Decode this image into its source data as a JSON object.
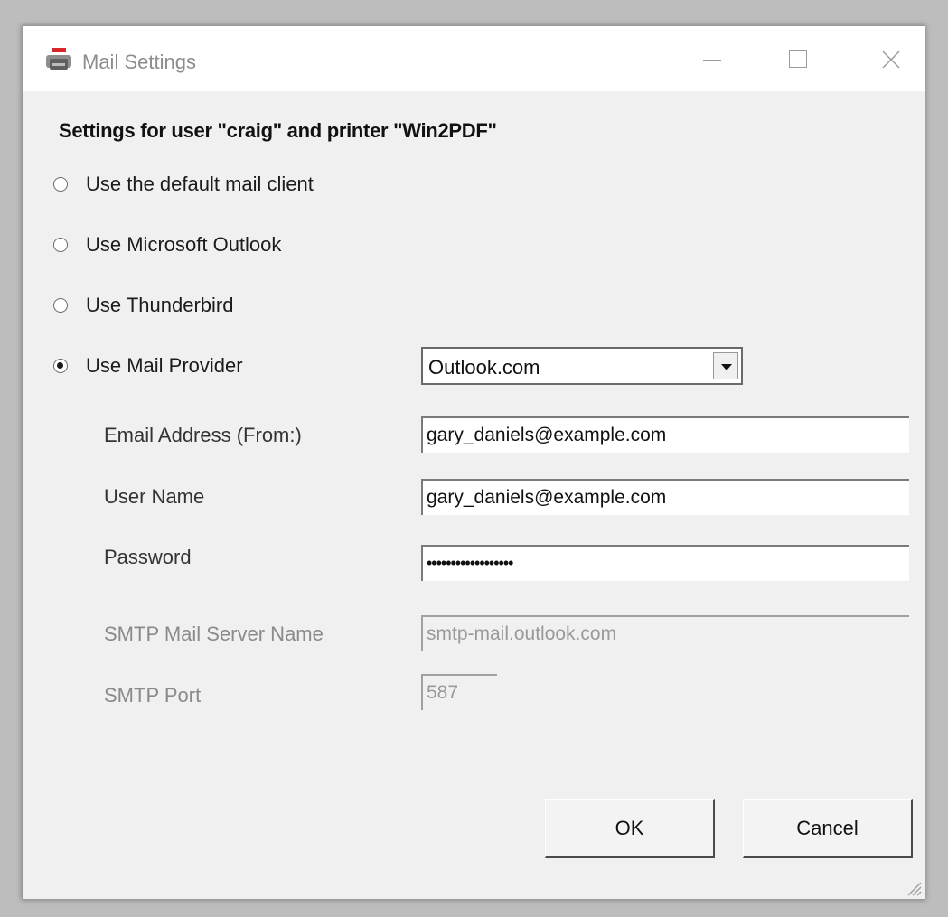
{
  "window": {
    "title": "Mail Settings"
  },
  "heading": "Settings for user \"craig\" and printer \"Win2PDF\"",
  "options": [
    {
      "label": "Use the default mail client",
      "selected": false
    },
    {
      "label": "Use Microsoft Outlook",
      "selected": false
    },
    {
      "label": "Use Thunderbird",
      "selected": false
    },
    {
      "label": "Use Mail Provider",
      "selected": true
    }
  ],
  "provider": {
    "selected": "Outlook.com"
  },
  "fields": {
    "email": {
      "label": "Email Address (From:)",
      "value": "gary_daniels@example.com"
    },
    "username": {
      "label": "User Name",
      "value": "gary_daniels@example.com"
    },
    "password": {
      "label": "Password",
      "value": "••••••••••••••••••"
    },
    "smtp_server": {
      "label": "SMTP Mail Server Name",
      "value": "smtp-mail.outlook.com"
    },
    "smtp_port": {
      "label": "SMTP Port",
      "value": "587"
    }
  },
  "buttons": {
    "ok": "OK",
    "cancel": "Cancel"
  }
}
